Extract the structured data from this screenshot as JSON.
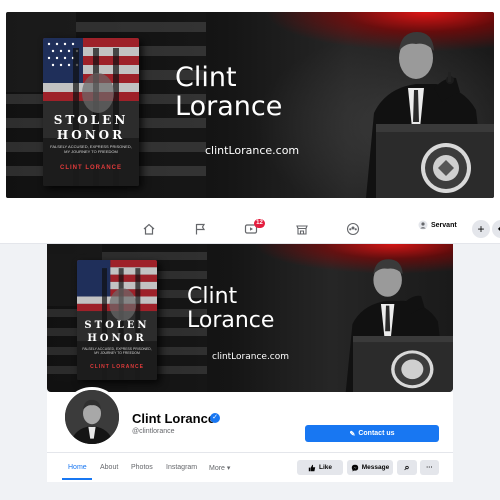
{
  "banner": {
    "name_line1": "Clint",
    "name_line2": "Lorance",
    "website": "clintLorance.com"
  },
  "book": {
    "title_line1": "STOLEN",
    "title_line2": "HONOR",
    "subtitle": "FALSELY ACCUSED, EXPRESS PRISONED, MY JOURNEY TO FREEDOM",
    "author": "CLINT LORANCE"
  },
  "nav": {
    "icons": [
      "home-icon",
      "flag-icon",
      "video-icon",
      "marketplace-icon",
      "groups-icon"
    ],
    "video_badge": "12",
    "account_label": "Servant",
    "plus_label": "+",
    "more_label": "◆"
  },
  "profile": {
    "name": "Clint Lorance",
    "verified_mark": "✓",
    "handle": "@clintlorance",
    "contact_button": "Contact us",
    "contact_icon": "✎",
    "tabs": [
      "Home",
      "About",
      "Photos",
      "Instagram",
      "More"
    ],
    "more_caret": "▾",
    "like_button": "Like",
    "message_button": "Message",
    "search_glyph": "⌕",
    "overflow_glyph": "···"
  },
  "colors": {
    "facebook_blue": "#1877f2",
    "notification_red": "#e41e3f",
    "banner_red": "#e61414",
    "banner_dark": "#0c0c0c"
  }
}
